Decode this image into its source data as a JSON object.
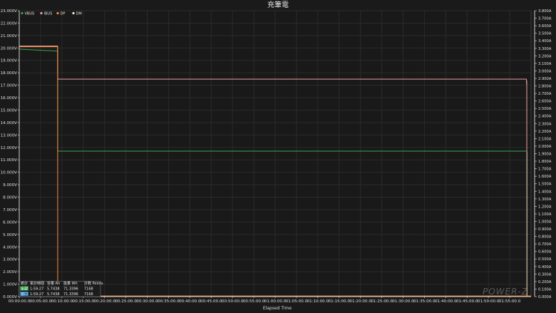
{
  "chart_data": {
    "type": "line",
    "title": "充筆電",
    "xlabel": "Elapsed Time",
    "x_unit": "seconds",
    "xlim": [
      0,
      7200
    ],
    "x_tick_labels": [
      "00:00:00.0",
      "00:05:00.0",
      "00:10:00.0",
      "00:15:00.0",
      "00:20:00.0",
      "00:25:00.0",
      "00:30:00.0",
      "00:35:00.0",
      "00:40:00.0",
      "00:45:00.0",
      "00:50:00.0",
      "00:55:00.0",
      "01:00:00.0",
      "01:05:00.0",
      "01:10:00.0",
      "01:15:00.0",
      "01:20:00.0",
      "01:25:00.0",
      "01:30:00.0",
      "01:35:00.0",
      "01:40:00.0",
      "01:45:00.0",
      "01:50:00.0",
      "01:55:00.0"
    ],
    "y_left": {
      "unit": "V",
      "ylim": [
        0,
        23
      ],
      "tick_labels": [
        "0.000V",
        "1.000V",
        "2.000V",
        "3.000V",
        "4.000V",
        "5.000V",
        "6.000V",
        "7.000V",
        "8.000V",
        "9.000V",
        "10.000V",
        "11.000V",
        "12.000V",
        "13.000V",
        "14.000V",
        "15.000V",
        "16.000V",
        "17.000V",
        "18.000V",
        "19.000V",
        "20.000V",
        "21.000V",
        "22.000V",
        "23.000V"
      ]
    },
    "y_right": {
      "unit": "A",
      "ylim": [
        0,
        3.8
      ],
      "tick_labels": [
        "0.000A",
        "0.100A",
        "0.200A",
        "0.300A",
        "0.400A",
        "0.500A",
        "0.600A",
        "0.700A",
        "0.800A",
        "0.900A",
        "1.000A",
        "1.100A",
        "1.200A",
        "1.300A",
        "1.400A",
        "1.500A",
        "1.600A",
        "1.700A",
        "1.800A",
        "1.900A",
        "2.000A",
        "2.100A",
        "2.200A",
        "2.300A",
        "2.400A",
        "2.500A",
        "2.600A",
        "2.700A",
        "2.800A",
        "2.900A",
        "3.000A",
        "3.100A",
        "3.200A",
        "3.300A",
        "3.400A",
        "3.500A",
        "3.600A",
        "3.700A",
        "3.800A"
      ]
    },
    "grid": true,
    "legend_position": "top-left",
    "series": [
      {
        "name": "VBUS",
        "axis": "left",
        "color": "#3aa34a",
        "x": [
          0,
          540,
          541,
          7135,
          7140,
          7145,
          7146,
          7200
        ],
        "y": [
          19.9,
          19.75,
          11.7,
          11.7,
          11.7,
          11.6,
          0.0,
          0.0
        ]
      },
      {
        "name": "IBUS",
        "axis": "right",
        "color": "#f0a0a8",
        "x": [
          0,
          540,
          541,
          7135,
          7138,
          7140,
          7141,
          7200
        ],
        "y": [
          3.33,
          3.33,
          2.89,
          2.89,
          2.82,
          2.87,
          0.0,
          0.0
        ]
      },
      {
        "name": "DP",
        "axis": "left",
        "color": "#ff8a3d",
        "x": [
          0,
          540,
          541,
          7200
        ],
        "y": [
          20.1,
          20.1,
          0.05,
          0.05
        ]
      },
      {
        "name": "DM",
        "axis": "left",
        "color": "#f5f0c8",
        "x": [
          0,
          7200
        ],
        "y": [
          0.0,
          0.0
        ]
      }
    ],
    "summary_table": {
      "headers": [
        "統計",
        "累計時間",
        "容量 Ah",
        "能量 Wh",
        "計數 Points"
      ],
      "rows": [
        {
          "label": "全部",
          "color": "#2e9a3e",
          "values": [
            "1:59:27",
            "5.7438",
            "71.3396",
            "7168"
          ]
        },
        {
          "label": "窗口",
          "color": "#1f6fb8",
          "values": [
            "1:59:27",
            "5.7438",
            "71.3396",
            "7168"
          ]
        }
      ]
    },
    "watermark": "POWER-Z"
  }
}
